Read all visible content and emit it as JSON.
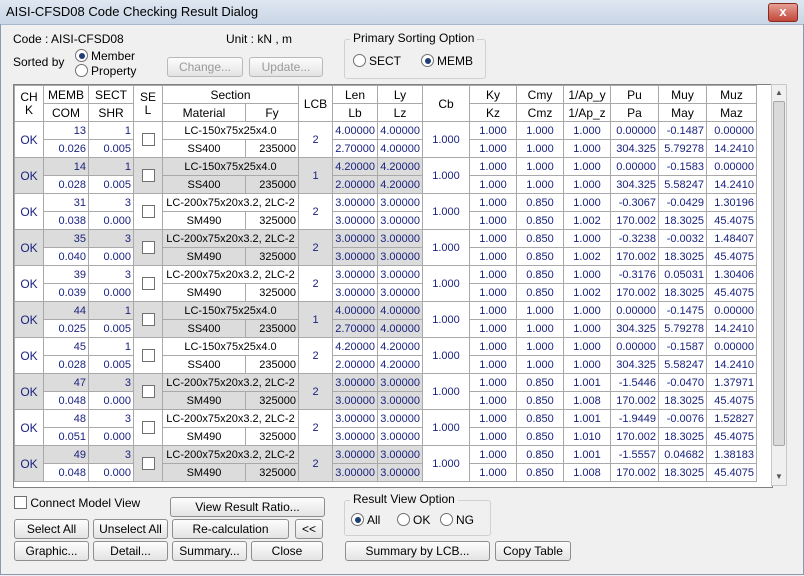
{
  "window": {
    "title": "AISI-CFSD08 Code Checking Result Dialog",
    "close": "x"
  },
  "info": {
    "code": "Code : AISI-CFSD08",
    "unit": "Unit : kN  ,    m"
  },
  "sorted": {
    "label": "Sorted by",
    "opt1": "Member",
    "opt2": "Property",
    "selected": "Member"
  },
  "buttons": {
    "change": "Change...",
    "update": "Update...",
    "view_ratio": "View Result Ratio...",
    "select_all": "Select All",
    "unselect_all": "Unselect All",
    "recalc": "Re-calculation",
    "collapse": "<<",
    "graphic": "Graphic...",
    "detail": "Detail...",
    "summary": "Summary...",
    "close": "Close",
    "summary_lcb": "Summary by LCB...",
    "copy_table": "Copy Table"
  },
  "primary": {
    "title": "Primary Sorting Option",
    "opt1": "SECT",
    "opt2": "MEMB",
    "selected": "MEMB"
  },
  "connect": "Connect Model View",
  "result_view": {
    "title": "Result View Option",
    "opt1": "All",
    "opt2": "OK",
    "opt3": "NG",
    "selected": "All"
  },
  "headers": {
    "chk": "CH K",
    "memb": "MEMB",
    "com": "COM",
    "sect": "SECT",
    "shr": "SHR",
    "sel": "SE L",
    "section": "Section",
    "material": "Material",
    "fy": "Fy",
    "lcb": "LCB",
    "len": "Len",
    "lb": "Lb",
    "ly": "Ly",
    "lz": "Lz",
    "cb": "Cb",
    "ky": "Ky",
    "kz": "Kz",
    "cmy": "Cmy",
    "cmz": "Cmz",
    "apy": "1/Ap_y",
    "apz": "1/Ap_z",
    "pu": "Pu",
    "pa": "Pa",
    "muy": "Muy",
    "may": "May",
    "muz": "Muz",
    "maz": "Maz"
  },
  "rows": [
    {
      "chk": "OK",
      "memb": "13",
      "com": "0.026",
      "sect": "1",
      "shr": "0.005",
      "section": "LC-150x75x25x4.0",
      "material": "SS400",
      "fy": "235000",
      "lcb": "2",
      "len": "4.00000",
      "lb": "2.70000",
      "ly": "4.00000",
      "lz": "4.00000",
      "cb": "1.000",
      "ky": "1.000",
      "kz": "1.000",
      "cmy": "1.000",
      "cmz": "1.000",
      "apy": "1.000",
      "apz": "1.000",
      "pu": "0.00000",
      "pa": "304.325",
      "muy": "-0.1487",
      "may": "5.79278",
      "muz": "0.00000",
      "maz": "14.2410"
    },
    {
      "chk": "OK",
      "memb": "14",
      "com": "0.028",
      "sect": "1",
      "shr": "0.005",
      "section": "LC-150x75x25x4.0",
      "material": "SS400",
      "fy": "235000",
      "lcb": "1",
      "len": "4.20000",
      "lb": "2.00000",
      "ly": "4.20000",
      "lz": "4.20000",
      "cb": "1.000",
      "ky": "1.000",
      "kz": "1.000",
      "cmy": "1.000",
      "cmz": "1.000",
      "apy": "1.000",
      "apz": "1.000",
      "pu": "0.00000",
      "pa": "304.325",
      "muy": "-0.1583",
      "may": "5.58247",
      "muz": "0.00000",
      "maz": "14.2410"
    },
    {
      "chk": "OK",
      "memb": "31",
      "com": "0.038",
      "sect": "3",
      "shr": "0.000",
      "section": "LC-200x75x20x3.2, 2LC-2",
      "material": "SM490",
      "fy": "325000",
      "lcb": "2",
      "len": "3.00000",
      "lb": "3.00000",
      "ly": "3.00000",
      "lz": "3.00000",
      "cb": "1.000",
      "ky": "1.000",
      "kz": "1.000",
      "cmy": "0.850",
      "cmz": "0.850",
      "apy": "1.000",
      "apz": "1.002",
      "pu": "-0.3067",
      "pa": "170.002",
      "muy": "-0.0429",
      "may": "18.3025",
      "muz": "1.30196",
      "maz": "45.4075"
    },
    {
      "chk": "OK",
      "memb": "35",
      "com": "0.040",
      "sect": "3",
      "shr": "0.000",
      "section": "LC-200x75x20x3.2, 2LC-2",
      "material": "SM490",
      "fy": "325000",
      "lcb": "2",
      "len": "3.00000",
      "lb": "3.00000",
      "ly": "3.00000",
      "lz": "3.00000",
      "cb": "1.000",
      "ky": "1.000",
      "kz": "1.000",
      "cmy": "0.850",
      "cmz": "0.850",
      "apy": "1.000",
      "apz": "1.002",
      "pu": "-0.3238",
      "pa": "170.002",
      "muy": "-0.0032",
      "may": "18.3025",
      "muz": "1.48407",
      "maz": "45.4075"
    },
    {
      "chk": "OK",
      "memb": "39",
      "com": "0.039",
      "sect": "3",
      "shr": "0.000",
      "section": "LC-200x75x20x3.2, 2LC-2",
      "material": "SM490",
      "fy": "325000",
      "lcb": "2",
      "len": "3.00000",
      "lb": "3.00000",
      "ly": "3.00000",
      "lz": "3.00000",
      "cb": "1.000",
      "ky": "1.000",
      "kz": "1.000",
      "cmy": "0.850",
      "cmz": "0.850",
      "apy": "1.000",
      "apz": "1.002",
      "pu": "-0.3176",
      "pa": "170.002",
      "muy": "0.05031",
      "may": "18.3025",
      "muz": "1.30406",
      "maz": "45.4075"
    },
    {
      "chk": "OK",
      "memb": "44",
      "com": "0.025",
      "sect": "1",
      "shr": "0.005",
      "section": "LC-150x75x25x4.0",
      "material": "SS400",
      "fy": "235000",
      "lcb": "1",
      "len": "4.00000",
      "lb": "2.70000",
      "ly": "4.00000",
      "lz": "4.00000",
      "cb": "1.000",
      "ky": "1.000",
      "kz": "1.000",
      "cmy": "1.000",
      "cmz": "1.000",
      "apy": "1.000",
      "apz": "1.000",
      "pu": "0.00000",
      "pa": "304.325",
      "muy": "-0.1475",
      "may": "5.79278",
      "muz": "0.00000",
      "maz": "14.2410"
    },
    {
      "chk": "OK",
      "memb": "45",
      "com": "0.028",
      "sect": "1",
      "shr": "0.005",
      "section": "LC-150x75x25x4.0",
      "material": "SS400",
      "fy": "235000",
      "lcb": "2",
      "len": "4.20000",
      "lb": "2.00000",
      "ly": "4.20000",
      "lz": "4.20000",
      "cb": "1.000",
      "ky": "1.000",
      "kz": "1.000",
      "cmy": "1.000",
      "cmz": "1.000",
      "apy": "1.000",
      "apz": "1.000",
      "pu": "0.00000",
      "pa": "304.325",
      "muy": "-0.1587",
      "may": "5.58247",
      "muz": "0.00000",
      "maz": "14.2410"
    },
    {
      "chk": "OK",
      "memb": "47",
      "com": "0.048",
      "sect": "3",
      "shr": "0.000",
      "section": "LC-200x75x20x3.2, 2LC-2",
      "material": "SM490",
      "fy": "325000",
      "lcb": "2",
      "len": "3.00000",
      "lb": "3.00000",
      "ly": "3.00000",
      "lz": "3.00000",
      "cb": "1.000",
      "ky": "1.000",
      "kz": "1.000",
      "cmy": "0.850",
      "cmz": "0.850",
      "apy": "1.001",
      "apz": "1.008",
      "pu": "-1.5446",
      "pa": "170.002",
      "muy": "-0.0470",
      "may": "18.3025",
      "muz": "1.37971",
      "maz": "45.4075"
    },
    {
      "chk": "OK",
      "memb": "48",
      "com": "0.051",
      "sect": "3",
      "shr": "0.000",
      "section": "LC-200x75x20x3.2, 2LC-2",
      "material": "SM490",
      "fy": "325000",
      "lcb": "2",
      "len": "3.00000",
      "lb": "3.00000",
      "ly": "3.00000",
      "lz": "3.00000",
      "cb": "1.000",
      "ky": "1.000",
      "kz": "1.000",
      "cmy": "0.850",
      "cmz": "0.850",
      "apy": "1.001",
      "apz": "1.010",
      "pu": "-1.9449",
      "pa": "170.002",
      "muy": "-0.0076",
      "may": "18.3025",
      "muz": "1.52827",
      "maz": "45.4075"
    },
    {
      "chk": "OK",
      "memb": "49",
      "com": "0.048",
      "sect": "3",
      "shr": "0.000",
      "section": "LC-200x75x20x3.2, 2LC-2",
      "material": "SM490",
      "fy": "325000",
      "lcb": "2",
      "len": "3.00000",
      "lb": "3.00000",
      "ly": "3.00000",
      "lz": "3.00000",
      "cb": "1.000",
      "ky": "1.000",
      "kz": "1.000",
      "cmy": "0.850",
      "cmz": "0.850",
      "apy": "1.001",
      "apz": "1.008",
      "pu": "-1.5557",
      "pa": "170.002",
      "muy": "0.04682",
      "may": "18.3025",
      "muz": "1.38183",
      "maz": "45.4075"
    }
  ]
}
